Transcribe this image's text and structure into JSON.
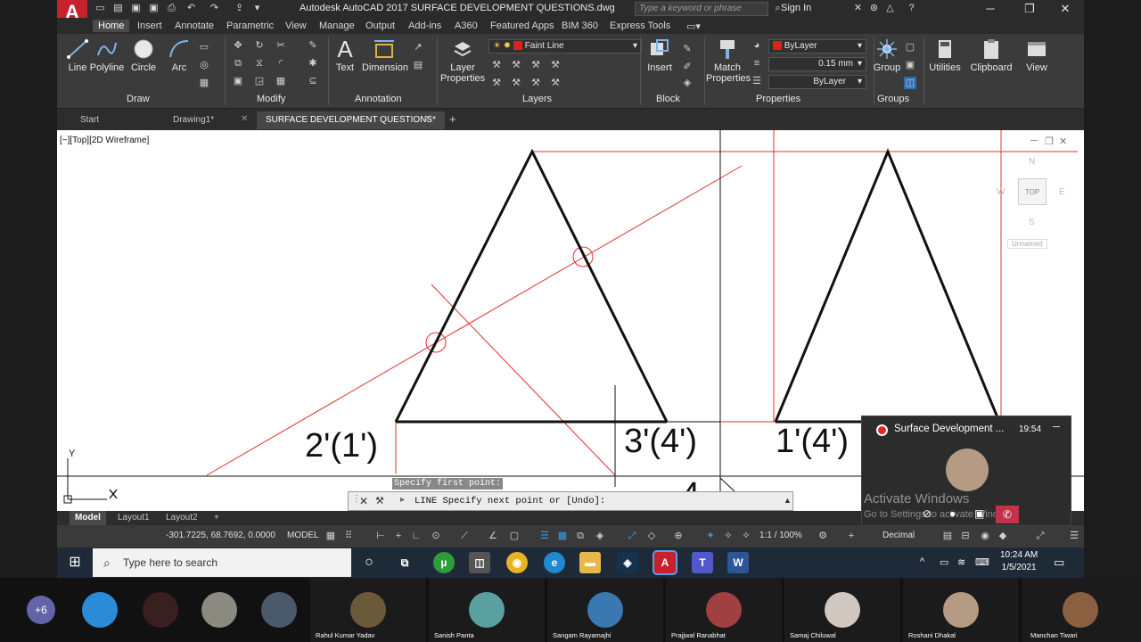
{
  "window": {
    "title": "Autodesk AutoCAD 2017    SURFACE DEVELOPMENT QUESTIONS.dwg",
    "search_placeholder": "Type a keyword or phrase",
    "signin": "Sign In",
    "logo": "A"
  },
  "ribbon_tabs": [
    "Home",
    "Insert",
    "Annotate",
    "Parametric",
    "View",
    "Manage",
    "Output",
    "Add-ins",
    "A360",
    "Featured Apps",
    "BIM 360",
    "Express Tools"
  ],
  "ribbon": {
    "draw": {
      "label": "Draw",
      "line": "Line",
      "polyline": "Polyline",
      "circle": "Circle",
      "arc": "Arc"
    },
    "modify": {
      "label": "Modify"
    },
    "annotation": {
      "label": "Annotation",
      "text": "Text",
      "dimension": "Dimension"
    },
    "layers": {
      "label": "Layers",
      "layer_properties": "Layer\nProperties",
      "current_layer": "Faint Line"
    },
    "block": {
      "label": "Block",
      "insert": "Insert"
    },
    "properties": {
      "label": "Properties",
      "match": "Match\nProperties",
      "color": "ByLayer",
      "lineweight": "0.15 mm",
      "linetype": "ByLayer"
    },
    "groups": {
      "label": "Groups",
      "group": "Group"
    },
    "utilities": "Utilities",
    "clipboard": "Clipboard",
    "view": "View"
  },
  "doc_tabs": [
    "Start",
    "Drawing1*",
    "SURFACE DEVELOPMENT QUESTIONS*"
  ],
  "viewport": {
    "label": "[−][Top][2D Wireframe]",
    "labels": [
      "2'(1')",
      "3'(4')",
      "1'(4')",
      "4"
    ],
    "viewcube": {
      "top": "TOP",
      "n": "N",
      "s": "S",
      "e": "E",
      "w": "W",
      "ucs": "Unnamed"
    },
    "ucs_y": "Y"
  },
  "command": {
    "prompt": "Specify first point:",
    "line": "LINE Specify next point or [Undo]:"
  },
  "layout_tabs": [
    "Model",
    "Layout1",
    "Layout2"
  ],
  "status": {
    "coords": "-301.7225, 68.7692, 0.0000",
    "model": "MODEL",
    "scale": "1:1 / 100%",
    "units": "Decimal"
  },
  "taskbar": {
    "search": "Type here to search",
    "time": "10:24 AM",
    "date": "1/5/2021"
  },
  "meeting": {
    "title": "Surface Development ...",
    "duration": "19:54",
    "activate": "Activate Windows",
    "activate_sub": "Go to Settings to activate Windows."
  },
  "participants": {
    "extra": "+6",
    "names": [
      "Rahul Kumar Yadav",
      "Sanish  Panta",
      "Sangam  Rayamajhi",
      "Prajjwal  Ranabhat",
      "Samaj  Chiluwal",
      "Roshani  Dhakal",
      "Manchan Tiwari"
    ]
  },
  "colors": {
    "accent_red": "#c8202c",
    "construction_red": "#e33030",
    "ribbon_bg": "#3b3b3b"
  }
}
